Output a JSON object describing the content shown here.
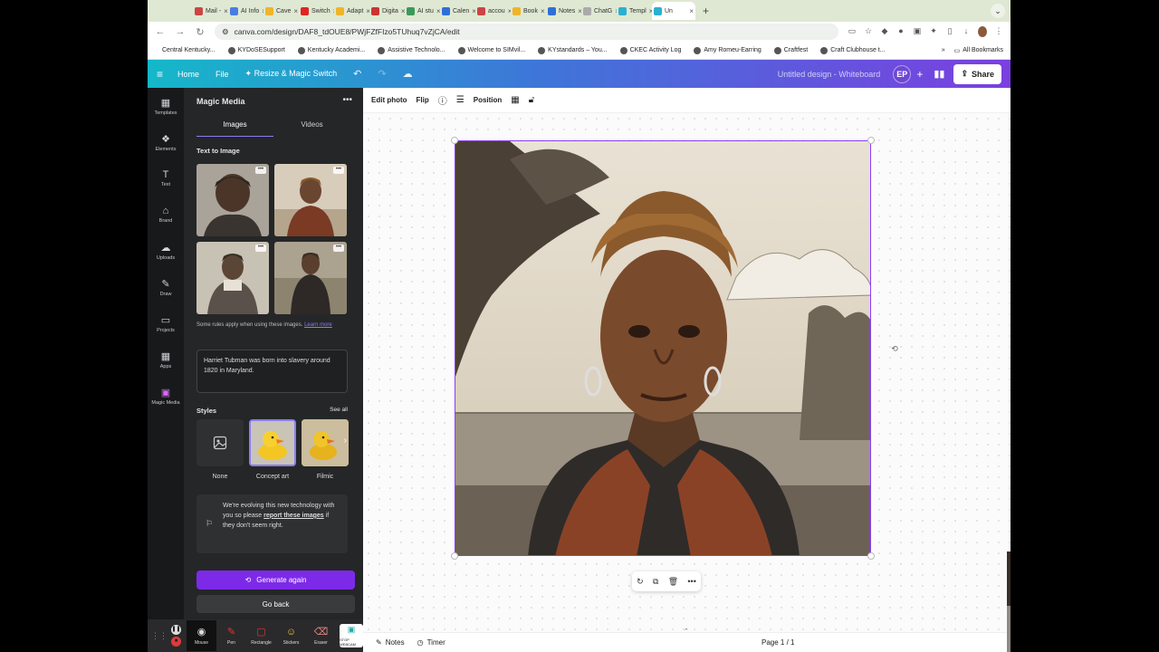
{
  "browser": {
    "tabs": [
      {
        "label": "Mail -",
        "color": "#c44"
      },
      {
        "label": "AI Info",
        "color": "#4a7de0"
      },
      {
        "label": "Cave",
        "color": "#f0b429"
      },
      {
        "label": "Switch",
        "color": "#e02424"
      },
      {
        "label": "Adapt",
        "color": "#f0b429"
      },
      {
        "label": "Digita",
        "color": "#c33"
      },
      {
        "label": "AI stu",
        "color": "#3a9a5a"
      },
      {
        "label": "Calen",
        "color": "#2f6fd8"
      },
      {
        "label": "accou",
        "color": "#c44"
      },
      {
        "label": "Book",
        "color": "#f0b429"
      },
      {
        "label": "Notes",
        "color": "#2f6fd8"
      },
      {
        "label": "ChatG",
        "color": "#aaa"
      },
      {
        "label": "Templ",
        "color": "#2ab0d0"
      },
      {
        "label": "Un",
        "color": "#2ab0d0",
        "active": true
      }
    ],
    "new_tab": "+",
    "url": "canva.com/design/DAF8_tdOUE8/PWjFZfFIzo5TUhuq7vZjCA/edit",
    "bookmarks": [
      "Central Kentucky...",
      "KYDoSESupport",
      "Kentucky Academi...",
      "Assistive Technolo...",
      "Welcome to SIMvil...",
      "KYstandards – You...",
      "CKEC Activity Log",
      "Amy Romeu-Earring",
      "Craftfest",
      "Craft Clubhouse t..."
    ],
    "bookmarks_more": "»",
    "all_bookmarks": "All Bookmarks"
  },
  "canva_header": {
    "home": "Home",
    "file": "File",
    "resize": "Resize & Magic Switch",
    "doc_title": "Untitled design - Whiteboard",
    "avatar_initials": "EP",
    "share": "Share"
  },
  "rail": [
    {
      "label": "Templates",
      "icon": "▦"
    },
    {
      "label": "Elements",
      "icon": "❖"
    },
    {
      "label": "Text",
      "icon": "T"
    },
    {
      "label": "Brand",
      "icon": "⌂"
    },
    {
      "label": "Uploads",
      "icon": "☁"
    },
    {
      "label": "Draw",
      "icon": "✎"
    },
    {
      "label": "Projects",
      "icon": "▭"
    },
    {
      "label": "Apps",
      "icon": "▦"
    },
    {
      "label": "Magic Media",
      "icon": "▣",
      "active": true
    }
  ],
  "panel": {
    "title": "Magic Media",
    "more": "•••",
    "tabs": [
      "Images",
      "Videos"
    ],
    "section": "Text to Image",
    "rules_text": "Some rules apply when using these images.",
    "rules_link": "Learn more",
    "prompt": "Harriet Tubman was born into slavery around 1820 in Maryland.",
    "styles_title": "Styles",
    "see_all": "See all",
    "styles": [
      "None",
      "Concept art",
      "Filmic"
    ],
    "notice_pre": "We're evolving this new technology with you so please",
    "notice_link": "report these images",
    "notice_post": "if they don't seem right.",
    "generate": "Generate again",
    "back": "Go back"
  },
  "recorder": {
    "tools": [
      "Mouse",
      "Pen",
      "Rectangle",
      "Stickers",
      "Eraser"
    ],
    "stop": "STOP WEBCAM"
  },
  "editor_toolbar": {
    "edit_photo": "Edit photo",
    "flip": "Flip",
    "position": "Position"
  },
  "footer": {
    "notes": "Notes",
    "timer": "Timer",
    "page": "Page 1 / 1"
  }
}
